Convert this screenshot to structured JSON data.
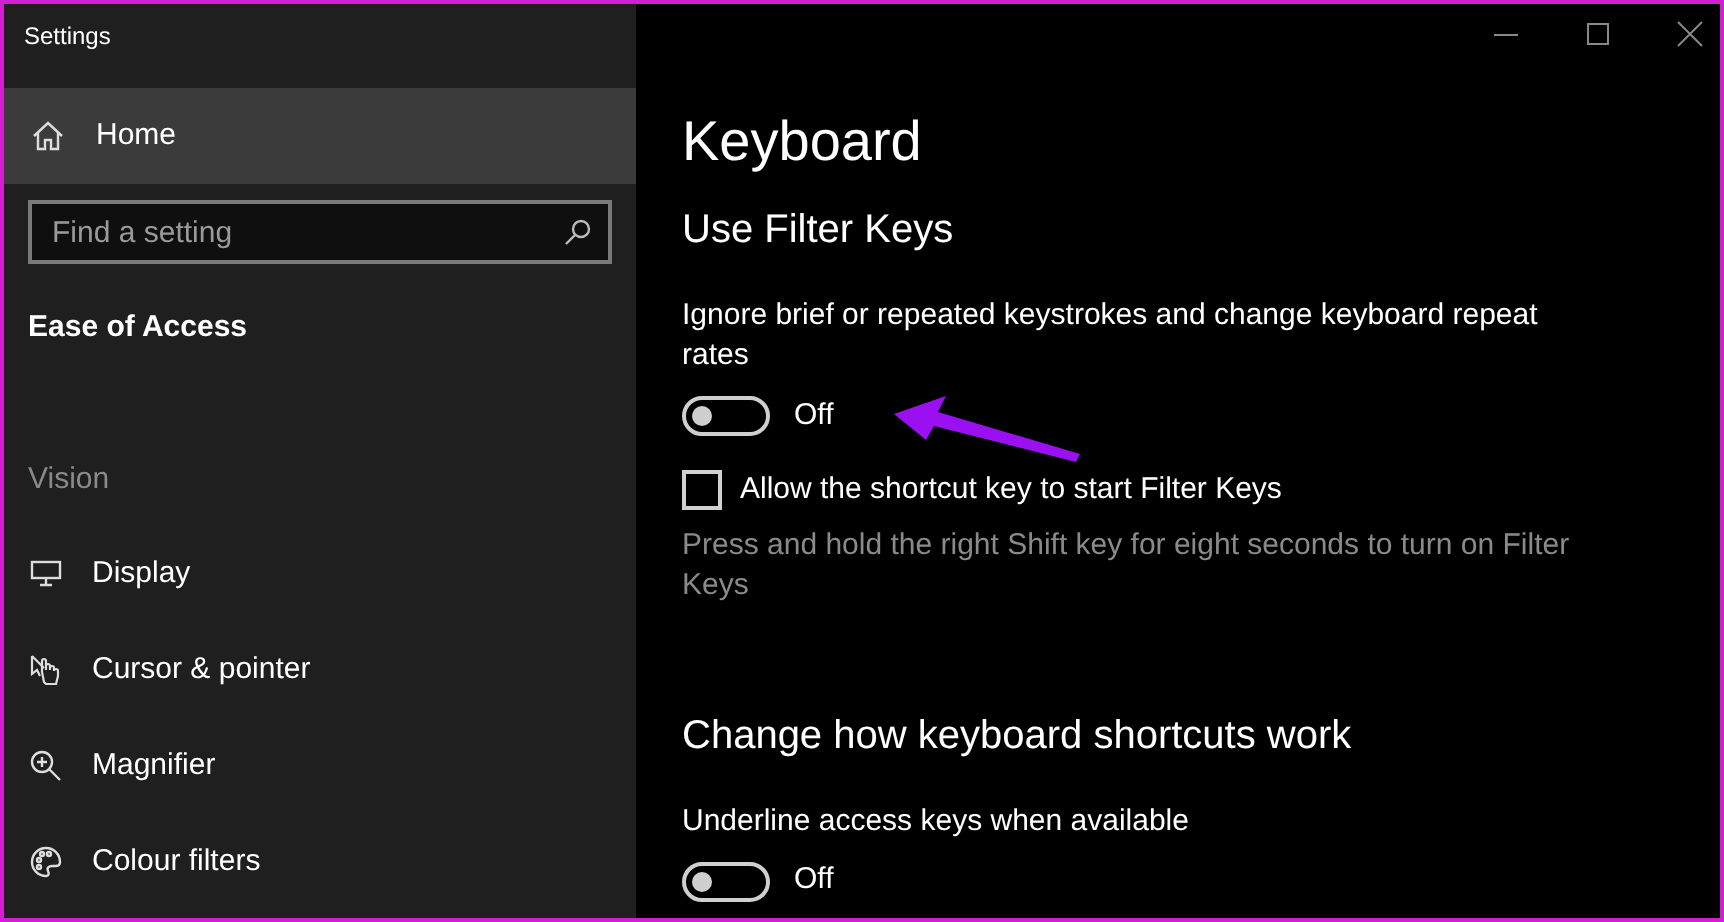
{
  "window": {
    "title": "Settings"
  },
  "sidebar": {
    "home": {
      "label": "Home",
      "selected": true
    },
    "search": {
      "placeholder": "Find a setting"
    },
    "section_title": "Ease of Access",
    "group_label": "Vision",
    "items": [
      {
        "label": "Display",
        "kind": "display",
        "selected": false
      },
      {
        "label": "Cursor & pointer",
        "kind": "cursor",
        "selected": false
      },
      {
        "label": "Magnifier",
        "kind": "magnifier",
        "selected": false
      },
      {
        "label": "Colour filters",
        "kind": "colour",
        "selected": false
      }
    ]
  },
  "page": {
    "title": "Keyboard",
    "sections": [
      {
        "heading": "Use Filter Keys",
        "settings": [
          {
            "kind": "toggle",
            "label": "Ignore brief or repeated keystrokes and change keyboard repeat rates",
            "on": false,
            "state_text": "Off"
          },
          {
            "kind": "checkbox",
            "label": "Allow the shortcut key to start Filter Keys",
            "checked": false,
            "help": "Press and hold the right Shift key for eight seconds to turn on Filter Keys"
          }
        ]
      },
      {
        "heading": "Change how keyboard shortcuts work",
        "settings": [
          {
            "kind": "toggle",
            "label": "Underline access keys when available",
            "on": false,
            "state_text": "Off"
          }
        ]
      }
    ]
  }
}
